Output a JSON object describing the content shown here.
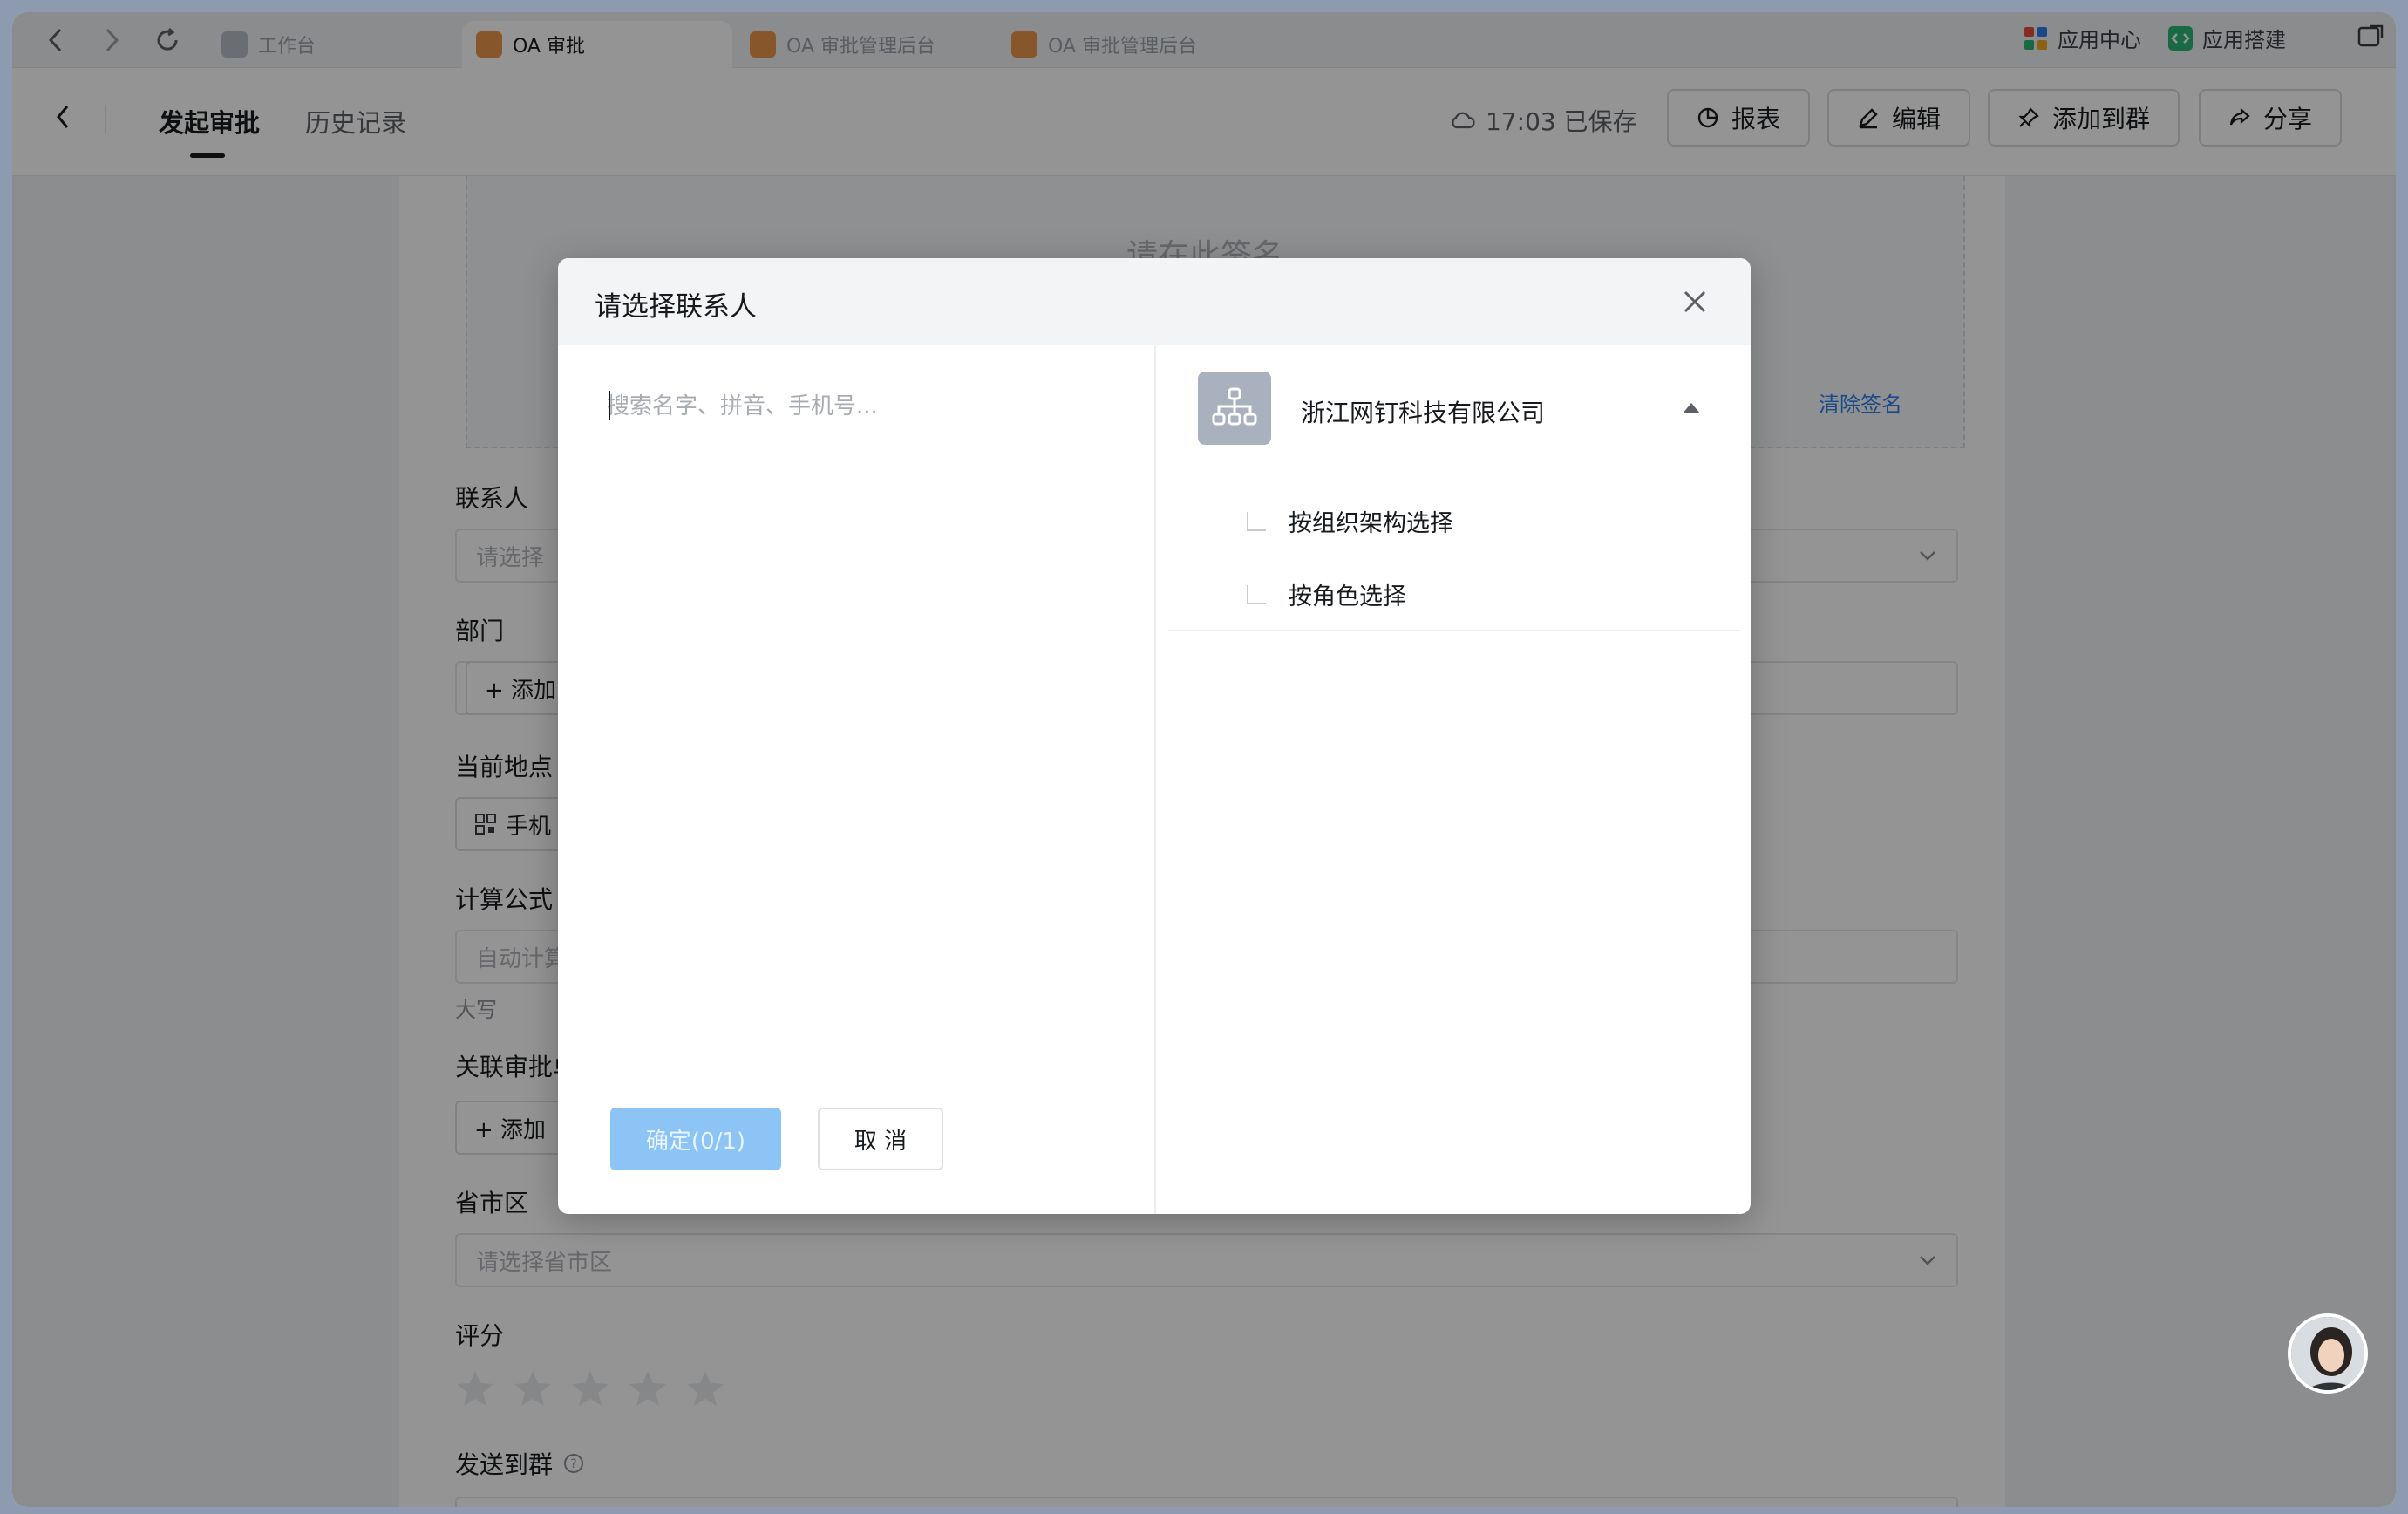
{
  "tabbar": {
    "tabs": [
      {
        "label": "工作台",
        "active": false
      },
      {
        "label": "OA 审批",
        "active": true
      },
      {
        "label": "OA 审批管理后台",
        "active": false
      },
      {
        "label": "OA 审批管理后台",
        "active": false
      }
    ],
    "app_center": "应用中心",
    "app_build": "应用搭建"
  },
  "header": {
    "tab_start": "发起审批",
    "tab_history": "历史记录",
    "saved_text": "17:03 已保存",
    "report_btn": "报表",
    "edit_btn": "编辑",
    "add_group_btn": "添加到群",
    "share_btn": "分享"
  },
  "form": {
    "signature_placeholder": "请在此签名",
    "clear_signature": "清除签名",
    "contact_label": "联系人",
    "contact_placeholder": "请选择",
    "dept_label": "部门",
    "dept_add": "+ 添加",
    "location_label": "当前地点",
    "location_btn": "手机",
    "formula_label": "计算公式",
    "formula_placeholder": "自动计算",
    "uppercase_label": "大写",
    "related_label": "关联审批单",
    "related_add": "+ 添加",
    "region_label": "省市区",
    "region_placeholder": "请选择省市区",
    "rating_label": "评分",
    "rating_value": 0,
    "rating_max": 5,
    "send_group_label": "发送到群"
  },
  "modal": {
    "title": "请选择联系人",
    "search_placeholder": "搜索名字、拼音、手机号...",
    "confirm": "确定(0/1)",
    "cancel": "取 消",
    "org_name": "浙江网钉科技有限公司",
    "option_org": "按组织架构选择",
    "option_role": "按角色选择"
  },
  "colors": {
    "primary": "#2f7dea",
    "confirm_disabled": "#8cc4f5",
    "overlay": "rgba(0,0,0,0.42)"
  }
}
